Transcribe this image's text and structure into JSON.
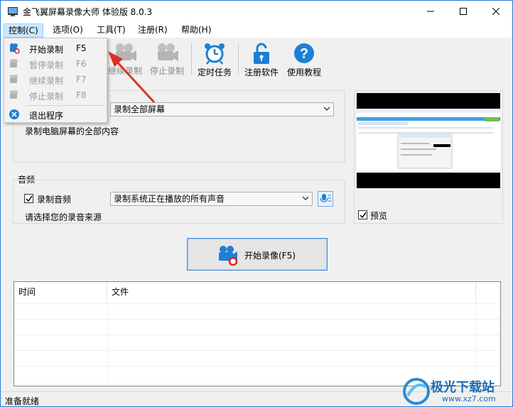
{
  "window": {
    "title": "金飞翼屏幕录像大师 体验版 8.0.3"
  },
  "menu": [
    {
      "label": "控制(C)",
      "active": true
    },
    {
      "label": "选项(O)"
    },
    {
      "label": "工具(T)"
    },
    {
      "label": "注册(R)"
    },
    {
      "label": "帮助(H)"
    }
  ],
  "dropdown": [
    {
      "label": "开始录制",
      "key": "F5",
      "enabled": true
    },
    {
      "label": "暂停录制",
      "key": "F6",
      "enabled": false
    },
    {
      "label": "继续录制",
      "key": "F7",
      "enabled": false
    },
    {
      "label": "停止录制",
      "key": "F8",
      "enabled": false
    },
    {
      "label": "退出程序",
      "key": "",
      "enabled": true
    }
  ],
  "toolbar": {
    "resume_label": "继续录制",
    "stop_label": "停止录制",
    "timer_label": "定时任务",
    "register_label": "注册软件",
    "help_label": "使用教程"
  },
  "record_area": {
    "mode_value": "录制全部屏幕",
    "mode_desc": "录制电脑屏幕的全部内容"
  },
  "audio": {
    "section_label": "音频",
    "checkbox_label": "录制音频",
    "checked": true,
    "source_value": "录制系统正在播放的所有声音",
    "hint": "请选择您的录音来源"
  },
  "preview": {
    "checkbox_label": "预览",
    "checked": true
  },
  "start_button": {
    "label": "开始录像(F5)"
  },
  "table": {
    "columns": [
      "时间",
      "文件"
    ]
  },
  "status": {
    "text": "准备就绪"
  },
  "watermark": {
    "text": "极光下载站",
    "url": "www.xz7.com"
  },
  "colors": {
    "accent": "#2b79d0",
    "icon_blue": "#1e7fd6",
    "record_red": "#e02020",
    "arrow_red": "#d9312c"
  }
}
